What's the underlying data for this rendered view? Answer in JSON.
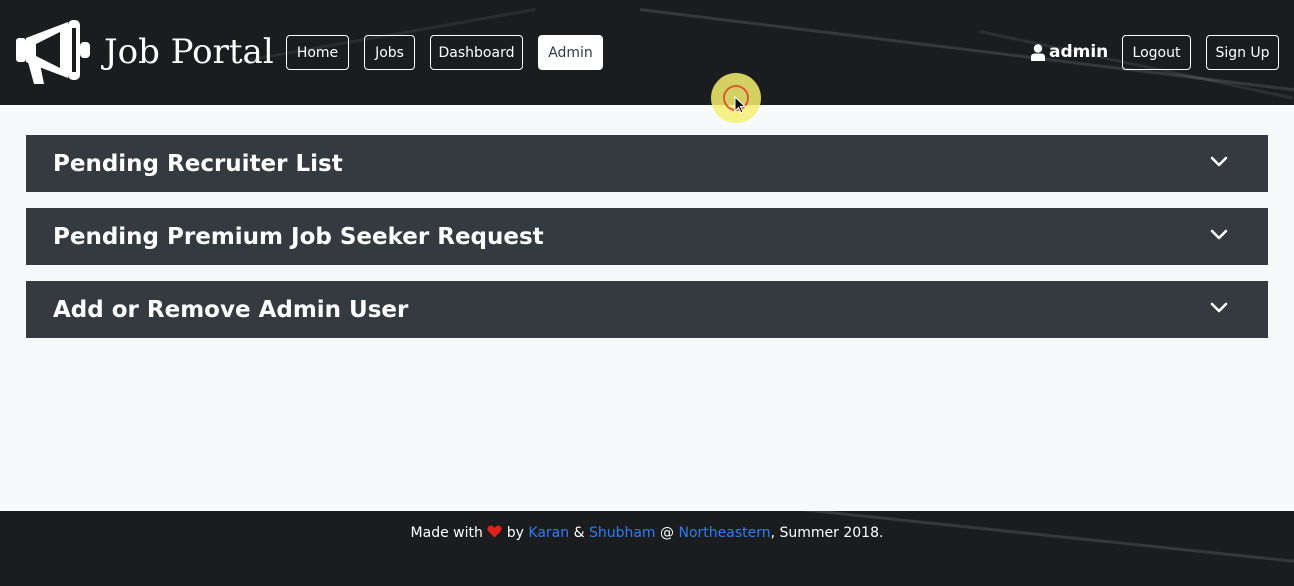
{
  "brand": {
    "title": "Job Portal",
    "logo_icon": "megaphone-icon"
  },
  "nav": [
    {
      "label": "Home",
      "active": false
    },
    {
      "label": "Jobs",
      "active": false
    },
    {
      "label": "Dashboard",
      "active": false
    },
    {
      "label": "Admin",
      "active": true
    }
  ],
  "user": {
    "name": "admin",
    "icon": "user-icon"
  },
  "auth": {
    "logout_label": "Logout",
    "signup_label": "Sign Up"
  },
  "panels": [
    {
      "title": "Pending Recruiter List",
      "icon": "chevron-down-icon"
    },
    {
      "title": "Pending Premium Job Seeker Request",
      "icon": "chevron-down-icon"
    },
    {
      "title": "Add or Remove Admin User",
      "icon": "chevron-down-icon"
    }
  ],
  "footer": {
    "made_with": "Made with",
    "heart_icon": "heart-icon",
    "by": "by",
    "author1": "Karan",
    "amp": "&",
    "author2": "Shubham",
    "at": "@",
    "org": "Northeastern",
    "suffix": ", Summer 2018."
  },
  "colors": {
    "header_bg": "#1b1c1e",
    "panel_bg": "#343a40",
    "page_bg": "#f8f9fa",
    "link": "#2f7cf6",
    "heart": "#e0201e"
  }
}
